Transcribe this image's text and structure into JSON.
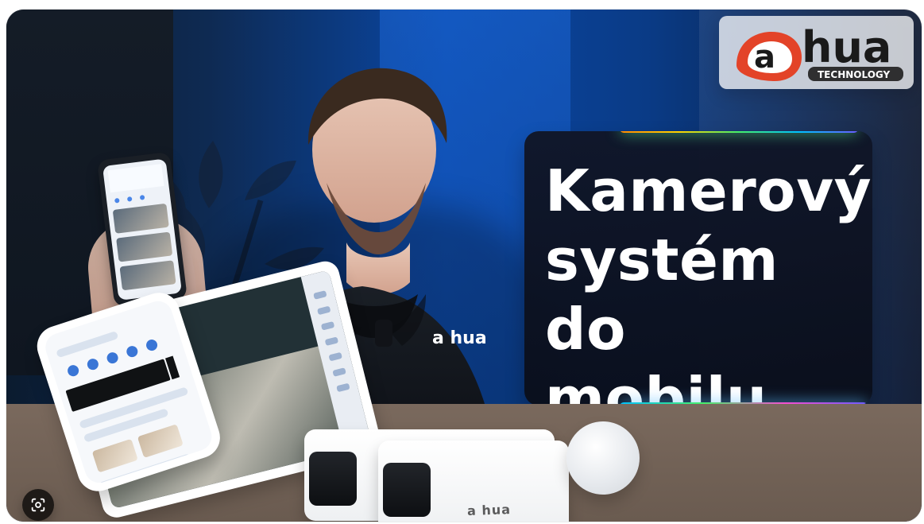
{
  "title_card": {
    "text": "Kamerový\nsystém\ndo mobilu"
  },
  "brand": {
    "logo_text": "a hua",
    "logo_subtext": "TECHNOLOGY",
    "shirt_logo": "a hua",
    "camera_logo": "a hua"
  },
  "ui": {
    "badge_icon": "camera-scan-icon"
  }
}
